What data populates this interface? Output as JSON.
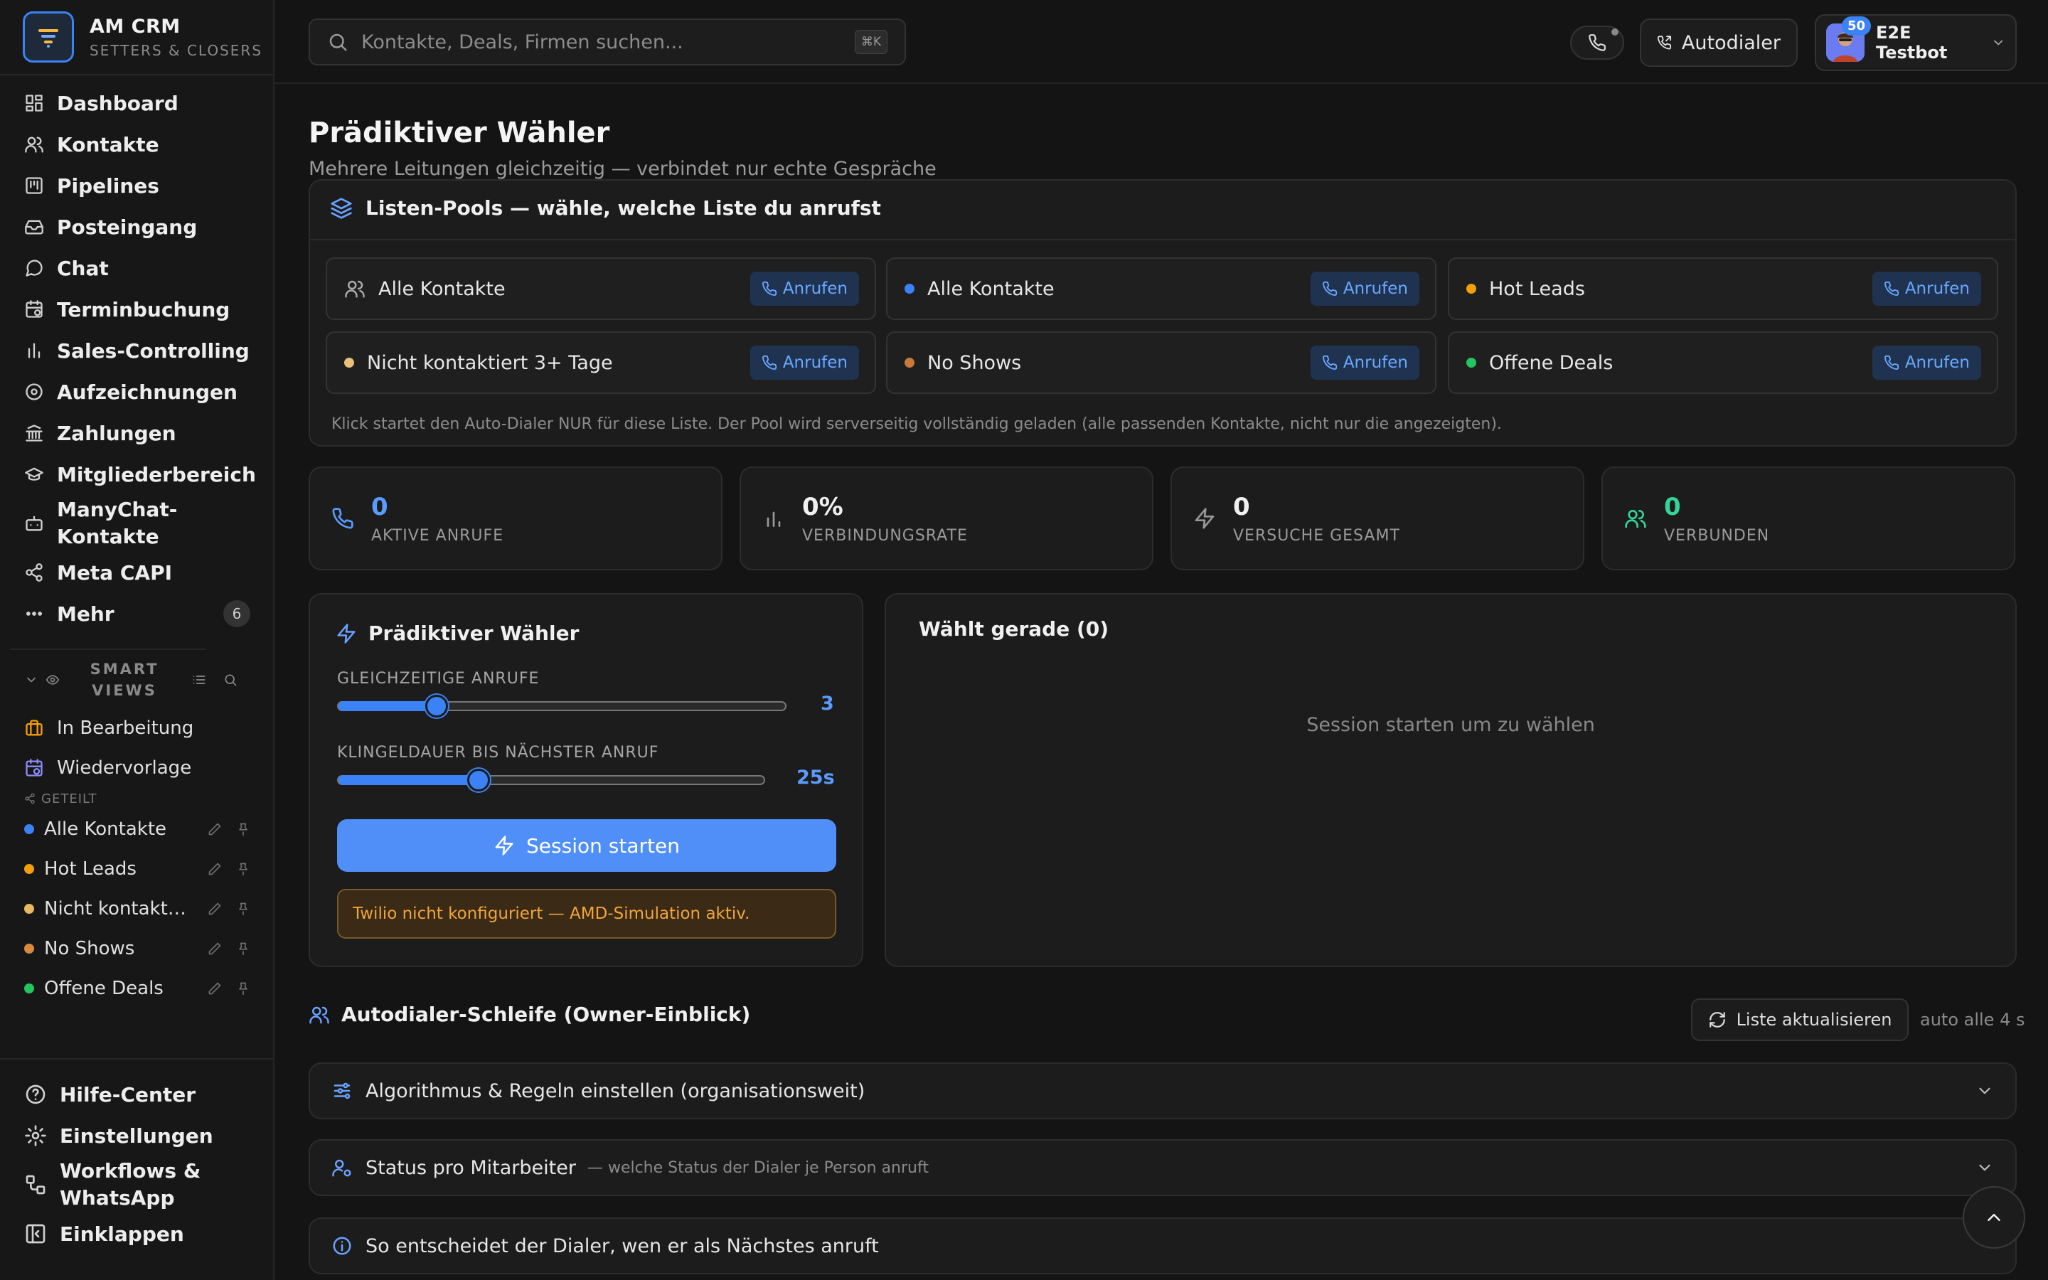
{
  "brand": {
    "title": "AM CRM",
    "subtitle": "SETTERS & CLOSERS"
  },
  "nav": {
    "dashboard": "Dashboard",
    "kontakte": "Kontakte",
    "pipelines": "Pipelines",
    "posteingang": "Posteingang",
    "chat": "Chat",
    "terminbuchung": "Terminbuchung",
    "sales_controlling": "Sales-Controlling",
    "aufzeichnungen": "Aufzeichnungen",
    "zahlungen": "Zahlungen",
    "mitgliederbereich": "Mitgliederbereich",
    "manychat": "ManyChat-Kontakte",
    "meta_capi": "Meta CAPI",
    "mehr": "Mehr",
    "mehr_count": "6"
  },
  "smart_views": {
    "title": "SMART VIEWS",
    "in_bearbeitung": "In Bearbeitung",
    "wiedervorlage": "Wiedervorlage",
    "shared_label": "GETEILT",
    "shared": [
      {
        "label": "Alle Kontakte",
        "color": "#3b82f6"
      },
      {
        "label": "Hot Leads",
        "color": "#f59e0b"
      },
      {
        "label": "Nicht kontaktiert 3+ Tage",
        "color": "#e8b860"
      },
      {
        "label": "No Shows",
        "color": "#d98a3a"
      },
      {
        "label": "Offene Deals",
        "color": "#22c55e"
      }
    ]
  },
  "sidebar_bottom": {
    "hilfe": "Hilfe-Center",
    "einstellungen": "Einstellungen",
    "workflows": "Workflows & WhatsApp",
    "einklappen": "Einklappen"
  },
  "topbar": {
    "search_placeholder": "Kontakte, Deals, Firmen suchen...",
    "search_shortcut": "⌘K",
    "autodialer": "Autodialer",
    "user_name": "E2E Testbot",
    "avatar_badge": "50"
  },
  "page": {
    "title": "Prädiktiver Wähler",
    "subtitle": "Mehrere Leitungen gleichzeitig — verbindet nur echte Gespräche"
  },
  "pools": {
    "title": "Listen-Pools — wähle, welche Liste du anrufst",
    "call_label": "Anrufen",
    "items": [
      {
        "label": "Alle Kontakte",
        "color": ""
      },
      {
        "label": "Alle Kontakte",
        "color": "#3b82f6"
      },
      {
        "label": "Hot Leads",
        "color": "#f59e0b"
      },
      {
        "label": "Nicht kontaktiert 3+ Tage",
        "color": "#e8c07a"
      },
      {
        "label": "No Shows",
        "color": "#c97a3a"
      },
      {
        "label": "Offene Deals",
        "color": "#22c55e"
      }
    ],
    "note": "Klick startet den Auto-Dialer NUR für diese Liste. Der Pool wird serverseitig vollständig geladen (alle passenden Kontakte, nicht nur die angezeigten)."
  },
  "stats": [
    {
      "value": "0",
      "label": "AKTIVE ANRUFE",
      "color": "#5a9bff"
    },
    {
      "value": "0%",
      "label": "VERBINDUNGSRATE",
      "color": "#f0f0f0"
    },
    {
      "value": "0",
      "label": "VERSUCHE GESAMT",
      "color": "#f0f0f0"
    },
    {
      "value": "0",
      "label": "VERBUNDEN",
      "color": "#34d399"
    }
  ],
  "dialer": {
    "title": "Prädiktiver Wähler",
    "concurrent_label": "GLEICHZEITIGE ANRUFE",
    "concurrent_value": "3",
    "concurrent_fraction": 0.22,
    "ring_label": "KLINGELDAUER BIS NÄCHSTER ANRUF",
    "ring_value": "25s",
    "ring_fraction": 0.33,
    "start_label": "Session starten",
    "warning": "Twilio nicht konfiguriert — AMD-Simulation aktiv."
  },
  "dialing": {
    "title": "Wählt gerade (0)",
    "empty": "Session starten um zu wählen"
  },
  "loop": {
    "title": "Autodialer-Schleife (Owner-Einblick)",
    "refresh": "Liste aktualisieren",
    "auto": "auto alle 4 s"
  },
  "accordions": {
    "algo": "Algorithmus & Regeln einstellen (organisationsweit)",
    "status": "Status pro Mitarbeiter",
    "status_hint": "— welche Status der Dialer je Person anruft",
    "decide": "So entscheidet der Dialer, wen er als Nächstes anruft"
  }
}
